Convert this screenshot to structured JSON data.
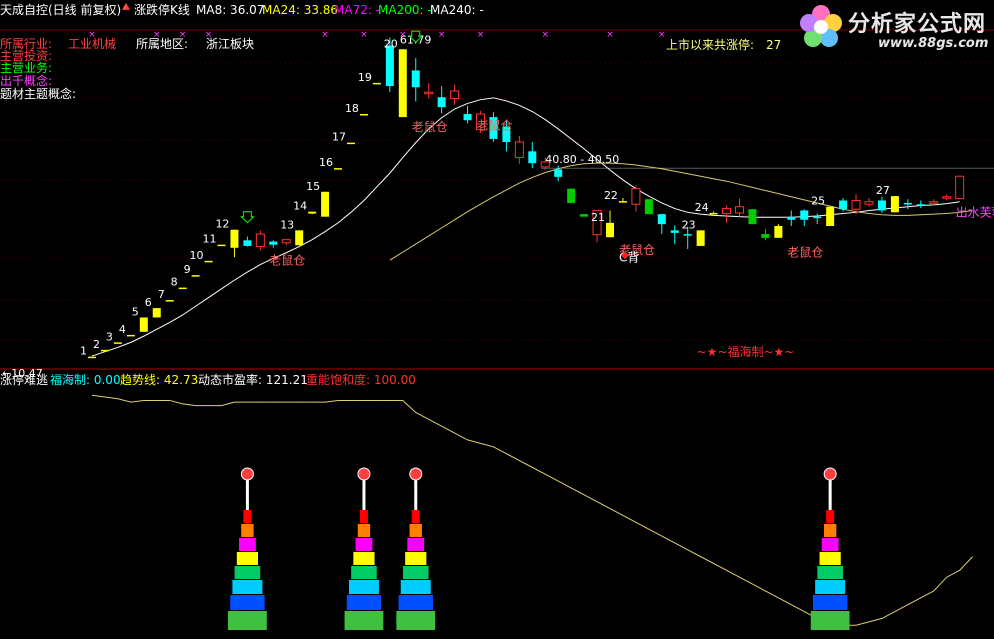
{
  "header": {
    "title": "天成自控(日线 前复权)",
    "indicator": "涨跌停K线",
    "ma8_label": "MA8: 36.07",
    "ma24_label": "MA24: 33.86",
    "ma72_label": "MA72: -",
    "ma200_label": "MA200: -",
    "ma240_label": "MA240: -"
  },
  "info": {
    "industry_label": "所属行业:",
    "industry_value": "工业机械",
    "region_label": "所属地区:",
    "region_value": "浙江板块",
    "main_invest_label": "主营投资:",
    "main_business_label": "主营业务:",
    "concept_label": "出千概念:",
    "theme_label": "题材主题概念:",
    "limitup_count_label": "上市以来共涨停:",
    "limitup_count_value": "27"
  },
  "watermark": {
    "name": "分析家公式网",
    "url": "www.88gs.com"
  },
  "lower_panel": {
    "name": "涨停难逃",
    "fuhai_label": "福海制: 0.00",
    "trend_label": "趋势线: 42.73",
    "pe_label": "动态市盈率: 121.21",
    "energy_label": "重能饱和度: 100.00"
  },
  "colors": {
    "white": "#ffffff",
    "yellow": "#ffff00",
    "cyan": "#00ffff",
    "red": "#ff3030",
    "green": "#00cc00",
    "magenta": "#ff00ff",
    "ma_line": "#ffffff",
    "ma24_line": "#d8c870"
  },
  "chart_data": {
    "type": "candlestick",
    "y_range": [
      9,
      63
    ],
    "start_price": "10.47",
    "start_label": "←10.47",
    "range_label": "40.80 - 40.50",
    "peak_label": "61.79",
    "candles": [
      {
        "o": 10.5,
        "h": 10.5,
        "l": 10.5,
        "c": 10.5,
        "type": "limit",
        "label": "1"
      },
      {
        "o": 11.6,
        "h": 11.6,
        "l": 11.6,
        "c": 11.6,
        "type": "limit",
        "label": "2"
      },
      {
        "o": 12.8,
        "h": 12.8,
        "l": 12.8,
        "c": 12.8,
        "type": "limit",
        "label": "3"
      },
      {
        "o": 14.0,
        "h": 14.0,
        "l": 14.0,
        "c": 14.0,
        "type": "limit",
        "label": "4"
      },
      {
        "o": 14.5,
        "h": 16.8,
        "l": 14.5,
        "c": 16.8,
        "type": "limit",
        "label": "5"
      },
      {
        "o": 16.8,
        "h": 18.3,
        "l": 16.8,
        "c": 18.3,
        "type": "limit",
        "label": "6"
      },
      {
        "o": 19.6,
        "h": 19.6,
        "l": 19.6,
        "c": 19.6,
        "type": "limit",
        "label": "7"
      },
      {
        "o": 21.6,
        "h": 21.6,
        "l": 21.6,
        "c": 21.6,
        "type": "limit",
        "label": "8"
      },
      {
        "o": 23.6,
        "h": 23.6,
        "l": 23.6,
        "c": 23.6,
        "type": "limit",
        "label": "9"
      },
      {
        "o": 25.9,
        "h": 25.9,
        "l": 25.9,
        "c": 25.9,
        "type": "limit",
        "label": "10"
      },
      {
        "o": 28.5,
        "h": 28.5,
        "l": 28.5,
        "c": 28.5,
        "type": "limit",
        "label": "11"
      },
      {
        "o": 28.0,
        "h": 30.9,
        "l": 26.5,
        "c": 30.9,
        "type": "limit",
        "label": "12"
      },
      {
        "o": 29.2,
        "h": 29.8,
        "l": 28.2,
        "c": 28.3,
        "type": "down"
      },
      {
        "o": 30.2,
        "h": 30.8,
        "l": 27.6,
        "c": 28.2,
        "type": "up"
      },
      {
        "o": 28.5,
        "h": 29.2,
        "l": 28.0,
        "c": 29.0,
        "type": "down"
      },
      {
        "o": 28.8,
        "h": 29.4,
        "l": 28.4,
        "c": 29.3,
        "type": "up"
      },
      {
        "o": 28.4,
        "h": 30.8,
        "l": 28.4,
        "c": 30.8,
        "type": "limit",
        "label": "13"
      },
      {
        "o": 33.5,
        "h": 33.8,
        "l": 33.4,
        "c": 33.8,
        "type": "limit",
        "label": "14"
      },
      {
        "o": 33.0,
        "h": 37.0,
        "l": 33.0,
        "c": 37.0,
        "type": "limit",
        "label": "15"
      },
      {
        "o": 40.8,
        "h": 40.8,
        "l": 40.8,
        "c": 40.8,
        "type": "limit",
        "label": "16"
      },
      {
        "o": 44.9,
        "h": 44.9,
        "l": 44.9,
        "c": 44.9,
        "type": "limit",
        "label": "17"
      },
      {
        "o": 49.5,
        "h": 49.5,
        "l": 49.5,
        "c": 49.5,
        "type": "limit",
        "label": "18"
      },
      {
        "o": 54.5,
        "h": 54.5,
        "l": 54.5,
        "c": 54.5,
        "type": "limit",
        "label": "19"
      },
      {
        "o": 60.5,
        "h": 61.8,
        "l": 53.0,
        "c": 54.0,
        "type": "down"
      },
      {
        "o": 49.0,
        "h": 59.9,
        "l": 49.0,
        "c": 59.9,
        "type": "limit",
        "label": "20"
      },
      {
        "o": 56.5,
        "h": 58.5,
        "l": 51.5,
        "c": 53.8,
        "type": "down"
      },
      {
        "o": 53.0,
        "h": 54.5,
        "l": 52.0,
        "c": 52.8,
        "type": "up"
      },
      {
        "o": 52.2,
        "h": 54.0,
        "l": 49.6,
        "c": 50.6,
        "type": "down"
      },
      {
        "o": 52.0,
        "h": 54.2,
        "l": 51.0,
        "c": 53.2,
        "type": "up"
      },
      {
        "o": 49.5,
        "h": 50.8,
        "l": 48.0,
        "c": 48.5,
        "type": "down"
      },
      {
        "o": 47.0,
        "h": 50.0,
        "l": 46.5,
        "c": 49.5,
        "type": "up"
      },
      {
        "o": 49.0,
        "h": 49.8,
        "l": 45.0,
        "c": 45.5,
        "type": "down"
      },
      {
        "o": 47.5,
        "h": 48.5,
        "l": 43.5,
        "c": 45.0,
        "type": "down"
      },
      {
        "o": 42.5,
        "h": 46.0,
        "l": 41.5,
        "c": 45.0,
        "type": "up"
      },
      {
        "o": 43.5,
        "h": 45.0,
        "l": 40.8,
        "c": 41.6,
        "type": "down"
      },
      {
        "o": 41.0,
        "h": 42.5,
        "l": 40.5,
        "c": 41.8,
        "type": "up"
      },
      {
        "o": 40.6,
        "h": 41.2,
        "l": 38.7,
        "c": 39.4,
        "type": "down"
      },
      {
        "o": 37.5,
        "h": 37.5,
        "l": 35.2,
        "c": 35.2,
        "type": "green"
      },
      {
        "o": 33.4,
        "h": 33.4,
        "l": 33.0,
        "c": 33.0,
        "type": "green"
      },
      {
        "o": 34.0,
        "h": 34.0,
        "l": 28.9,
        "c": 30.1,
        "type": "up"
      },
      {
        "o": 29.7,
        "h": 34.0,
        "l": 29.7,
        "c": 32.0,
        "type": "limit",
        "label": "21"
      },
      {
        "o": 35.5,
        "h": 36.0,
        "l": 35.3,
        "c": 35.5,
        "type": "limit",
        "label": "22"
      },
      {
        "o": 37.5,
        "h": 38.0,
        "l": 33.8,
        "c": 35.0,
        "type": "up"
      },
      {
        "o": 35.8,
        "h": 35.8,
        "l": 33.4,
        "c": 33.4,
        "type": "green"
      },
      {
        "o": 33.4,
        "h": 33.4,
        "l": 30.2,
        "c": 31.8,
        "type": "down"
      },
      {
        "o": 30.8,
        "h": 31.6,
        "l": 28.6,
        "c": 30.4,
        "type": "down"
      },
      {
        "o": 30.2,
        "h": 31.4,
        "l": 27.8,
        "c": 30.0,
        "type": "down"
      },
      {
        "o": 28.3,
        "h": 30.8,
        "l": 28.3,
        "c": 30.8,
        "type": "limit",
        "label": "23"
      },
      {
        "o": 33.6,
        "h": 33.8,
        "l": 33.5,
        "c": 33.6,
        "type": "limit",
        "label": "24"
      },
      {
        "o": 33.5,
        "h": 34.8,
        "l": 32.0,
        "c": 34.3,
        "type": "up"
      },
      {
        "o": 33.6,
        "h": 35.9,
        "l": 32.8,
        "c": 34.6,
        "type": "up"
      },
      {
        "o": 34.2,
        "h": 34.2,
        "l": 31.8,
        "c": 31.8,
        "type": "green"
      },
      {
        "o": 30.2,
        "h": 31.0,
        "l": 29.2,
        "c": 29.6,
        "type": "green"
      },
      {
        "o": 29.6,
        "h": 31.8,
        "l": 29.6,
        "c": 31.5,
        "type": "limit"
      },
      {
        "o": 33.0,
        "h": 34.0,
        "l": 31.5,
        "c": 32.5,
        "type": "down"
      },
      {
        "o": 34.0,
        "h": 34.2,
        "l": 31.5,
        "c": 32.5,
        "type": "down"
      },
      {
        "o": 32.8,
        "h": 33.5,
        "l": 31.8,
        "c": 33.0,
        "type": "down"
      },
      {
        "o": 31.5,
        "h": 34.6,
        "l": 31.5,
        "c": 34.6,
        "type": "limit",
        "label": "25"
      },
      {
        "o": 35.6,
        "h": 36.0,
        "l": 33.8,
        "c": 34.2,
        "type": "down"
      },
      {
        "o": 34.2,
        "h": 36.6,
        "l": 33.4,
        "c": 35.6,
        "type": "up"
      },
      {
        "o": 35.4,
        "h": 36.0,
        "l": 34.6,
        "c": 35.0,
        "type": "up"
      },
      {
        "o": 35.6,
        "h": 36.2,
        "l": 33.6,
        "c": 34.0,
        "type": "down"
      },
      {
        "o": 33.7,
        "h": 36.3,
        "l": 33.7,
        "c": 36.3,
        "type": "limit",
        "label": "27"
      },
      {
        "o": 35.2,
        "h": 35.8,
        "l": 34.2,
        "c": 35.0,
        "type": "down"
      },
      {
        "o": 35.0,
        "h": 35.6,
        "l": 34.4,
        "c": 34.8,
        "type": "down"
      },
      {
        "o": 35.3,
        "h": 35.8,
        "l": 34.8,
        "c": 35.4,
        "type": "up"
      },
      {
        "o": 36.0,
        "h": 36.6,
        "l": 35.6,
        "c": 36.2,
        "type": "up"
      },
      {
        "o": 35.9,
        "h": 39.5,
        "l": 35.9,
        "c": 39.5,
        "type": "up"
      }
    ],
    "ma8": [
      10.6,
      11.3,
      12.0,
      12.8,
      13.8,
      14.9,
      16.0,
      17.2,
      18.6,
      20.0,
      21.4,
      22.8,
      24.1,
      25.3,
      26.3,
      27.2,
      28.2,
      29.3,
      30.6,
      32.0,
      33.7,
      35.6,
      37.8,
      40.0,
      42.5,
      44.9,
      47.1,
      48.9,
      50.3,
      51.2,
      51.8,
      52.1,
      51.6,
      50.9,
      49.9,
      48.6,
      47.1,
      45.5,
      43.9,
      42.2,
      40.5,
      38.9,
      37.5,
      36.3,
      35.2,
      34.3,
      33.7,
      33.4,
      33.2,
      33.1,
      33.0,
      32.9,
      32.9,
      32.9,
      32.9,
      33.0,
      33.1,
      33.3,
      33.5,
      33.7,
      34.0,
      34.2,
      34.4,
      34.6,
      34.8,
      34.9,
      35.1,
      35.4
    ],
    "ma24_start_index": 23,
    "ma24": [
      26.0,
      27.3,
      28.6,
      29.9,
      31.2,
      32.5,
      33.8,
      35.0,
      36.2,
      37.3,
      38.4,
      39.3,
      40.1,
      40.7,
      41.2,
      41.5,
      41.6,
      41.6,
      41.5,
      41.3,
      41.0,
      40.7,
      40.3,
      39.9,
      39.5,
      39.1,
      38.7,
      38.2,
      37.7,
      37.2,
      36.7,
      36.2,
      35.7,
      35.2,
      34.7,
      34.2,
      33.8,
      33.5,
      33.3,
      33.2,
      33.2,
      33.3,
      33.4,
      33.5,
      33.7,
      34.0
    ],
    "annotations": [
      {
        "text": "老鼠仓",
        "index": 14,
        "price": 25.3
      },
      {
        "text": "老鼠仓",
        "index": 25,
        "price": 46.8
      },
      {
        "text": "老鼠仓",
        "index": 30,
        "price": 47.0
      },
      {
        "text": "老鼠仓",
        "index": 41,
        "price": 27.0
      },
      {
        "text": "C背",
        "index": 41,
        "price": 25.8
      },
      {
        "text": "老鼠仓",
        "index": 54,
        "price": 26.6
      },
      {
        "text": "出水芙蓉",
        "index": 67,
        "price": 33.0
      }
    ],
    "green_arrows": [
      {
        "index": 12,
        "price": 33.8
      },
      {
        "index": 25,
        "price": 62.8
      }
    ],
    "red_markers": [
      {
        "index": 0,
        "price": 61.6
      },
      {
        "index": 5,
        "price": 61.6
      },
      {
        "index": 7,
        "price": 61.6
      },
      {
        "index": 9,
        "price": 61.6
      },
      {
        "index": 18,
        "price": 61.6
      },
      {
        "index": 21,
        "price": 61.6
      },
      {
        "index": 24,
        "price": 61.6
      },
      {
        "index": 27,
        "price": 61.6
      },
      {
        "index": 30,
        "price": 61.6
      },
      {
        "index": 35,
        "price": 61.6
      },
      {
        "index": 40,
        "price": 61.6
      },
      {
        "index": 44,
        "price": 61.6
      }
    ],
    "signal_label": "~★~福海制~★~",
    "signal_index": 50,
    "trend_line": [
      31,
      30.5,
      30,
      29,
      29.5,
      29.5,
      29.5,
      28.5,
      28,
      28,
      28,
      29,
      29,
      29,
      29,
      29,
      29,
      29,
      29,
      29.5,
      29.5,
      29.5,
      29.5,
      29.5,
      29.5,
      26,
      24,
      22,
      20,
      18,
      17,
      16,
      14,
      12,
      10,
      8,
      6,
      4,
      2,
      0,
      -2,
      -4,
      -6,
      -8,
      -10,
      -12,
      -14,
      -16,
      -18,
      -20,
      -22,
      -24,
      -26,
      -28,
      -30,
      -32,
      -34,
      -35,
      -36,
      -36,
      -35,
      -34,
      -32,
      -30,
      -28,
      -26,
      -22,
      -20,
      -16
    ],
    "trend_y_range": [
      -40,
      34
    ],
    "energy_towers": [
      12,
      21,
      25,
      57
    ]
  }
}
